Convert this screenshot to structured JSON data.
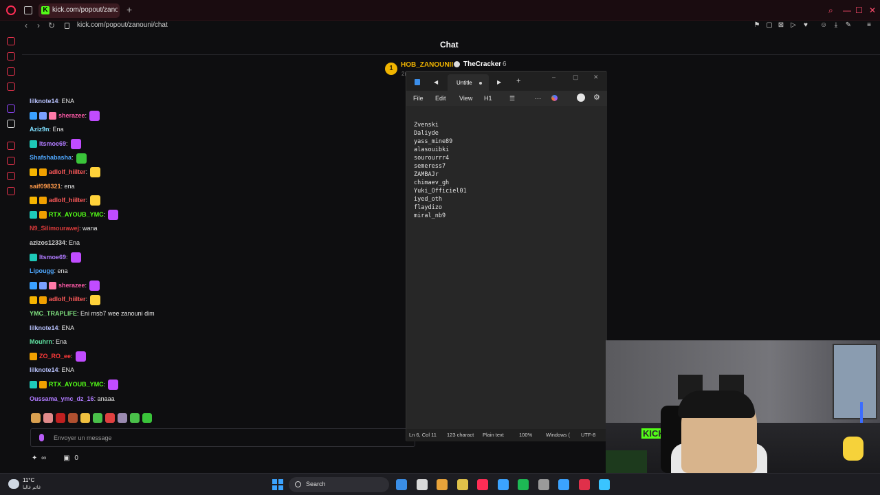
{
  "browser": {
    "tab_title": "kick.com/popout/zanouni/",
    "tab_favicon": "K",
    "new_tab": "+",
    "url": "kick.com/popout/zanouni/chat",
    "accent": "#ff2d55"
  },
  "chat": {
    "title": "Chat",
    "pinned": {
      "badge": "1",
      "user": "HOB_ZANOUNII",
      "name": "TheCracker",
      "count": "6",
      "tail": "2("
    },
    "messages": [
      {
        "user": "lilknote14",
        "color": "#b9c3ff",
        "text": ": ENA",
        "badges": [],
        "emote": ""
      },
      {
        "user": "sherazee",
        "color": "#ff5aa8",
        "text": ":",
        "badges": [
          "#3aa0ff",
          "#7aa0ff",
          "#ff7aa8"
        ],
        "emote": "#c04cff"
      },
      {
        "user": "Aziz9n",
        "color": "#7fe0ff",
        "text": ": Ena",
        "badges": [],
        "emote": ""
      },
      {
        "user": "Itsmoe69",
        "color": "#b07bff",
        "text": ":",
        "badges": [
          "#1ec9b8"
        ],
        "emote": "#c04cff"
      },
      {
        "user": "Shafshabasha",
        "color": "#4fa8ff",
        "text": ":",
        "badges": [],
        "emote": "#3ac43a"
      },
      {
        "user": "adlolf_hiilter",
        "color": "#ff5a5a",
        "text": ":",
        "badges": [
          "#f5b400",
          "#f0a000"
        ],
        "emote": "#ffd23a"
      },
      {
        "user": "saif098321",
        "color": "#ff9a4a",
        "text": ": ena",
        "badges": [],
        "emote": ""
      },
      {
        "user": "adlolf_hiilter",
        "color": "#ff5a5a",
        "text": ":",
        "badges": [
          "#f5b400",
          "#f0a000"
        ],
        "emote": "#ffd23a"
      },
      {
        "user": "RTX_AYOUB_YMC",
        "color": "#53fc18",
        "text": ":",
        "badges": [
          "#1ec9b8",
          "#f0a000"
        ],
        "emote": "#c04cff"
      },
      {
        "user": "N9_Silimourawej",
        "color": "#d93a3a",
        "text": ": wana",
        "badges": [],
        "emote": ""
      },
      {
        "user": "azizos12334",
        "color": "#d0d0d0",
        "text": ": Ena",
        "badges": [],
        "emote": ""
      },
      {
        "user": "Itsmoe69",
        "color": "#b07bff",
        "text": ":",
        "badges": [
          "#1ec9b8"
        ],
        "emote": "#c04cff"
      },
      {
        "user": "Lipougg",
        "color": "#4fa8ff",
        "text": ": ena",
        "badges": [],
        "emote": ""
      },
      {
        "user": "sherazee",
        "color": "#ff5aa8",
        "text": ":",
        "badges": [
          "#3aa0ff",
          "#7aa0ff",
          "#ff7aa8"
        ],
        "emote": "#c04cff"
      },
      {
        "user": "adlolf_hiilter",
        "color": "#ff5a5a",
        "text": ":",
        "badges": [
          "#f5b400",
          "#f0a000"
        ],
        "emote": "#ffd23a"
      },
      {
        "user": "YMC_TRAPLIFE",
        "color": "#7fe07f",
        "text": ": Eni msb7 wee zanouni dim",
        "badges": [],
        "emote": ""
      },
      {
        "user": "lilknote14",
        "color": "#b9c3ff",
        "text": ": ENA",
        "badges": [],
        "emote": ""
      },
      {
        "user": "Mouhrn",
        "color": "#5fe0a0",
        "text": ": Ena",
        "badges": [],
        "emote": ""
      },
      {
        "user": "ZO_RO_ee",
        "color": "#ff3a3a",
        "text": ":",
        "badges": [
          "#f0a000"
        ],
        "emote": "#c04cff"
      },
      {
        "user": "lilknote14",
        "color": "#b9c3ff",
        "text": ": ENA",
        "badges": [],
        "emote": ""
      },
      {
        "user": "RTX_AYOUB_YMC",
        "color": "#53fc18",
        "text": ":",
        "badges": [
          "#1ec9b8",
          "#f0a000"
        ],
        "emote": "#c04cff"
      },
      {
        "user": "Oussama_ymc_dz_16",
        "color": "#b07bff",
        "text": ": anaaa",
        "badges": [],
        "emote": ""
      }
    ],
    "emote_bar": [
      "#d9a050",
      "#e08a8a",
      "#c02020",
      "#b05030",
      "#f0c040",
      "#4ac04a",
      "#e04040",
      "#9a8ab0",
      "#4ac04a",
      "#3ac43a"
    ],
    "input_placeholder": "Envoyer un message",
    "footer_count": "0"
  },
  "notepad": {
    "tab_title": "Untitle",
    "menu": {
      "file": "File",
      "edit": "Edit",
      "view": "View",
      "heading": "H1"
    },
    "lines": [
      "Zvenski",
      "Daliyde",
      "yass_mine89",
      "alasouibki",
      "sourourrr4",
      "semeress7",
      "ZAMBAJr",
      "chimaev_gh",
      "Yuki_Officiel01",
      "iyed_oth",
      "flaydizo",
      "miral_nb9"
    ],
    "status": {
      "position": "Ln 6, Col 11",
      "chars": "123 charact",
      "format": "Plain text",
      "zoom": "100%",
      "eol": "Windows (",
      "encoding": "UTF-8"
    }
  },
  "webcam": {
    "sign": "KICK"
  },
  "taskbar": {
    "weather_temp": "11°C",
    "weather_desc": "غائم غالبا",
    "search_label": "Search",
    "apps": [
      "#3a8ee6",
      "#d9d9d9",
      "#e8a33a",
      "#e0c24a",
      "#ff2d55",
      "#3ba3ff",
      "#1db954",
      "#9a9a9a",
      "#3ba3ff",
      "#e0304a",
      "#3ac4ff"
    ]
  }
}
